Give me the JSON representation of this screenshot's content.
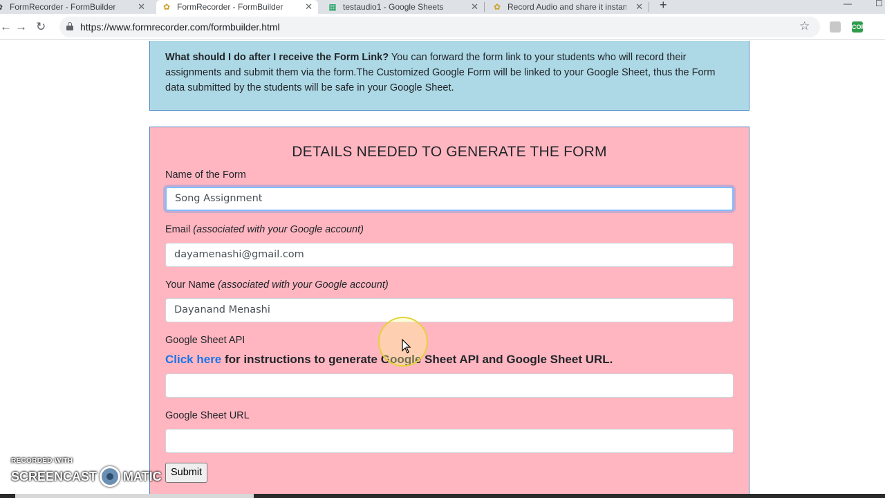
{
  "browser": {
    "tabs": [
      {
        "title": "FormRecorder - FormBuilder",
        "icon": "formrecorder-favicon",
        "active": false
      },
      {
        "title": "FormRecorder - FormBuilder",
        "icon": "formrecorder-favicon",
        "active": true
      },
      {
        "title": "testaudio1 - Google Sheets",
        "icon": "google-sheets-favicon",
        "active": false
      },
      {
        "title": "Record Audio and share it instan",
        "icon": "formrecorder-favicon",
        "active": false
      }
    ],
    "url": "https://www.formrecorder.com/formbuilder.html",
    "extensions": {
      "cors": "CORS"
    }
  },
  "info": {
    "question": "What should I do after I receive the Form Link?",
    "answer": " You can forward the form link to your students who will record their assignments and submit them via the form.The Customized Google Form will be linked to your Google Sheet, thus the Form data submitted by the students will be safe in your Google Sheet."
  },
  "form": {
    "heading": "DETAILS NEEDED TO GENERATE THE FORM",
    "form_name": {
      "label": "Name of the Form",
      "value": "Song Assignment"
    },
    "email": {
      "label": "Email ",
      "note": "(associated with your Google account)",
      "value": "dayamenashi@gmail.com"
    },
    "your_name": {
      "label": "Your Name ",
      "note": "(associated with your Google account)",
      "value": "Dayanand Menashi"
    },
    "sheet_api": {
      "label": "Google Sheet API",
      "link_text": "Click here",
      "instructions": " for instructions to generate Google Sheet API and Google Sheet URL.",
      "value": ""
    },
    "sheet_url": {
      "label": "Google Sheet URL",
      "value": ""
    },
    "submit_label": "Submit"
  },
  "watermark": {
    "line1": "RECORDED WITH",
    "left": "SCREENCAST",
    "right": "MATIC"
  },
  "colors": {
    "info_bg": "#add8e6",
    "form_bg": "#ffb6c1",
    "link": "#1a73e8",
    "border": "#4a86c8"
  }
}
